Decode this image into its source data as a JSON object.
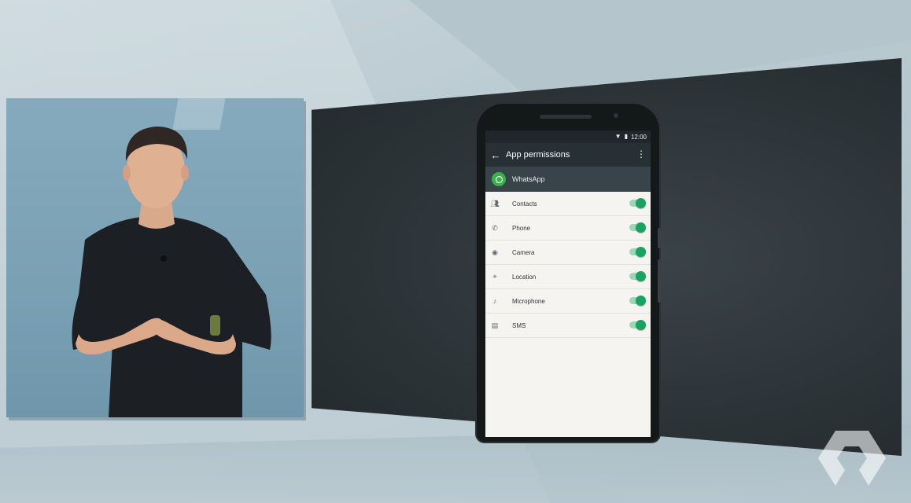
{
  "phone": {
    "status_time": "12:00",
    "app_bar": {
      "back_icon": "arrow-back-icon",
      "title": "App permissions",
      "menu_icon": "more-vert-icon"
    },
    "app": {
      "name": "WhatsApp",
      "icon": "whatsapp-icon"
    },
    "permissions": [
      {
        "label": "Contacts",
        "icon": "contacts-icon",
        "enabled": true
      },
      {
        "label": "Phone",
        "icon": "phone-icon",
        "enabled": true
      },
      {
        "label": "Camera",
        "icon": "camera-icon",
        "enabled": true
      },
      {
        "label": "Location",
        "icon": "location-icon",
        "enabled": true
      },
      {
        "label": "Microphone",
        "icon": "microphone-icon",
        "enabled": true
      },
      {
        "label": "SMS",
        "icon": "sms-icon",
        "enabled": true
      }
    ]
  },
  "colors": {
    "toggle_on": "#1aa260",
    "toggle_track": "#9bd6b9",
    "app_bar": "#263035",
    "app_header": "#38444a",
    "whatsapp_green": "#39b24a"
  }
}
